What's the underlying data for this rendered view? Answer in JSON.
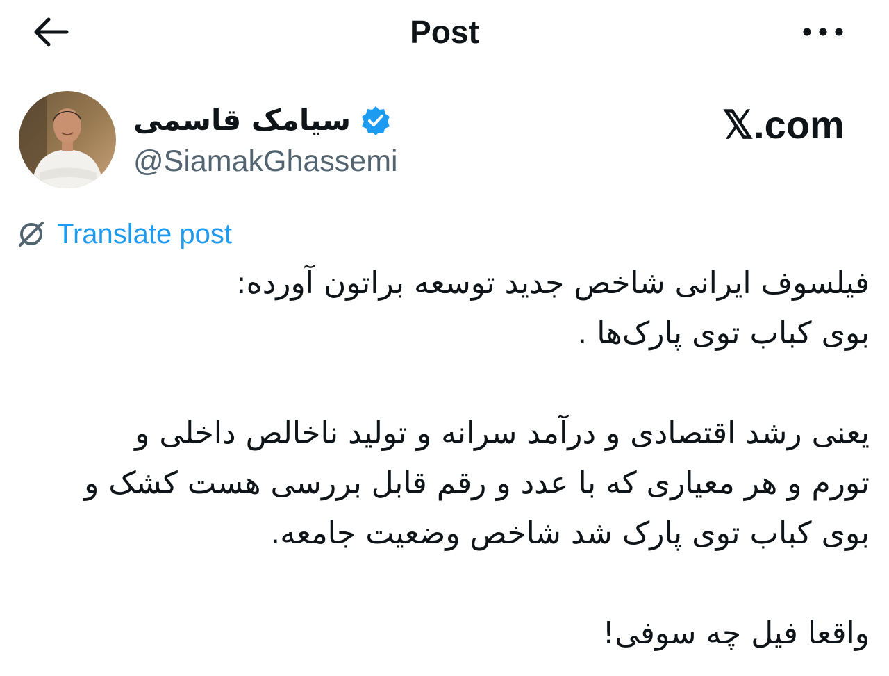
{
  "header": {
    "title": "Post",
    "back_icon": "arrow-left-icon",
    "more_icon": "more-horizontal-icon"
  },
  "author": {
    "display_name": "سیامک قاسمی",
    "handle": "@SiamakGhassemi",
    "verified": true,
    "verified_color": "#1d9bf0"
  },
  "site_mark": {
    "text": "𝕏.com"
  },
  "translate": {
    "label": "Translate post",
    "icon": "translate-icon",
    "color": "#1d9bf0"
  },
  "post": {
    "paragraphs": [
      {
        "lines": [
          "فیلسوف ایرانی شاخص جدید توسعه براتون آورده:",
          "بوی کباب توی پارک‌ها ."
        ]
      },
      {
        "lines": [
          "یعنی رشد اقتصادی و درآمد سرانه و تولید ناخالص داخلی و",
          "تورم و هر معیاری که با عدد و رقم قابل بررسی هست کشک و",
          "بوی کباب توی پارک شد شاخص وضعیت جامعه."
        ]
      },
      {
        "lines": [
          "واقعا فیل چه سوفی!"
        ]
      }
    ]
  },
  "colors": {
    "text": "#0f1419",
    "secondary_text": "#536471",
    "accent": "#1d9bf0"
  }
}
